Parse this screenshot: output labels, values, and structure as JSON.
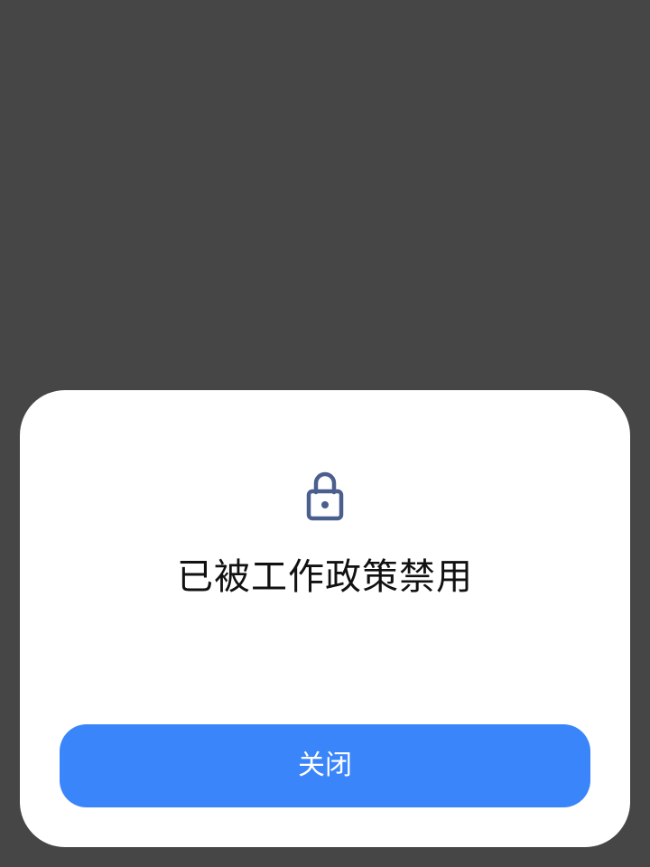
{
  "dialog": {
    "icon": "lock-icon",
    "title": "已被工作政策禁用",
    "close_label": "关闭"
  },
  "colors": {
    "backdrop": "#464646",
    "dialog_background": "#ffffff",
    "accent": "#3a85fa",
    "icon": "#4b5f8e",
    "title_text": "#111111"
  }
}
